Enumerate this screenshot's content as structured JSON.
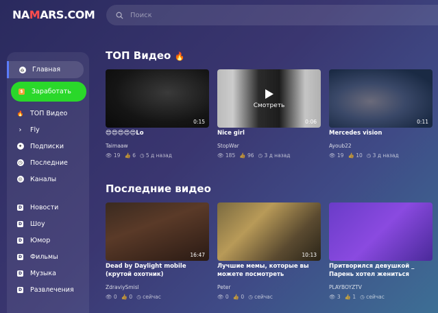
{
  "brand": {
    "logo_prefix": "NA",
    "logo_accent": "M",
    "logo_rest": "ARS.COM",
    "accent_color": "#ff4d4d"
  },
  "search": {
    "placeholder": "Поиск"
  },
  "sidebar": {
    "items": [
      {
        "label": "Главная",
        "icon": "home-icon"
      },
      {
        "label": "Заработать",
        "icon": "money-bag-icon",
        "color": "#2ad82a"
      },
      {
        "label": "ТОП Видео",
        "icon": "fire-icon"
      },
      {
        "label": "Fly",
        "icon": "chevron-right-icon"
      },
      {
        "label": "Подписки",
        "icon": "subscriptions-icon"
      },
      {
        "label": "Последние",
        "icon": "clock-icon"
      },
      {
        "label": "Каналы",
        "icon": "channels-icon"
      }
    ],
    "categories": [
      {
        "label": "Новости",
        "icon": "category-icon"
      },
      {
        "label": "Шоу",
        "icon": "category-icon"
      },
      {
        "label": "Юмор",
        "icon": "category-icon"
      },
      {
        "label": "Фильмы",
        "icon": "category-icon"
      },
      {
        "label": "Музыка",
        "icon": "category-icon"
      },
      {
        "label": "Развлечения",
        "icon": "category-icon"
      }
    ]
  },
  "top": {
    "title": "ТОП Видео",
    "videos": [
      {
        "title": "😍😍😍😍😍Lo",
        "author": "Taimaaw",
        "views": "19",
        "likes": "6",
        "time": "5 д назад",
        "duration": "0:15",
        "overlay": ""
      },
      {
        "title": "Nice girl",
        "author": "StopWar",
        "views": "185",
        "likes": "96",
        "time": "3 д назад",
        "duration": "0:06",
        "overlay": "Смотреть"
      },
      {
        "title": "Mercedes vision",
        "author": "Ayoub22",
        "views": "19",
        "likes": "10",
        "time": "3 д назад",
        "duration": "0:11",
        "overlay": ""
      }
    ]
  },
  "latest": {
    "title": "Последние видео",
    "videos": [
      {
        "title": "Dead by Daylight mobile (крутой охотник)",
        "author": "ZdraviySmisl",
        "views": "0",
        "likes": "0",
        "time": "сейчас",
        "duration": "16:47",
        "overlay": ""
      },
      {
        "title": "Лучшие мемы, которые вы можете посмотреть",
        "author": "Peter",
        "views": "0",
        "likes": "0",
        "time": "сейчас",
        "duration": "10:13",
        "overlay": ""
      },
      {
        "title": "Притворился девушкой _ Парень хотел жениться",
        "author": "PLAYBOYZTV",
        "views": "3",
        "likes": "1",
        "time": "сейчас",
        "duration": "",
        "overlay": ""
      }
    ]
  }
}
